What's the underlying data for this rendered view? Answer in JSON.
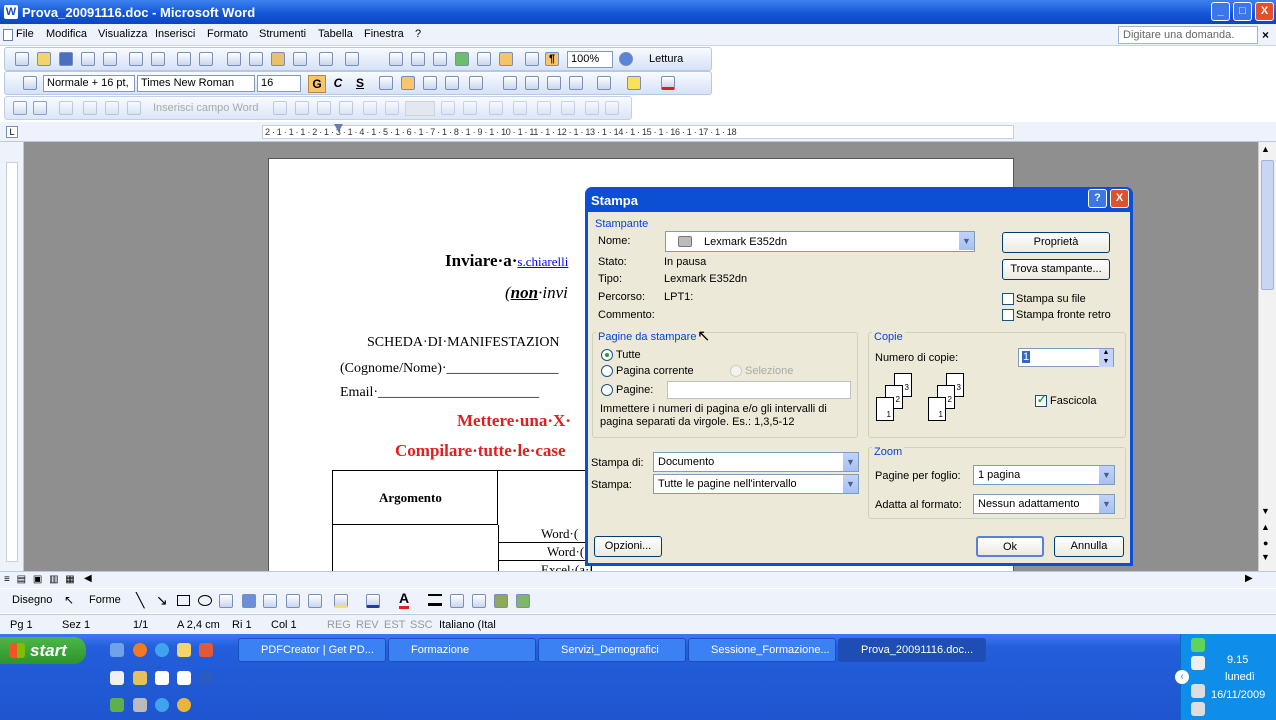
{
  "window": {
    "title": "Prova_20091116.doc - Microsoft Word",
    "min": "_",
    "max": "□",
    "close": "X"
  },
  "menu": {
    "items": [
      "File",
      "Modifica",
      "Visualizza",
      "Inserisci",
      "Formato",
      "Strumenti",
      "Tabella",
      "Finestra",
      "?"
    ],
    "ask": "Digitare una domanda."
  },
  "toolbar": {
    "zoom": "100%",
    "reading": "Lettura",
    "style": "Normale + 16 pt,",
    "font": "Times New Roman",
    "size": "16",
    "bold": "G",
    "italic": "C",
    "underline": "S",
    "field": "Inserisci campo Word"
  },
  "ruler": {
    "marks": "2 · 1 · 1 · 1 · 2 · 1 · 3 · 1 · 4 · 1 · 5 · 1 · 6 · 1 · 7 · 1 · 8 · 1 · 9 · 1 · 10 · 1 · 11 · 1 · 12 · 1 · 13 · 1 · 14 · 1 · 15 · 1 · 16 · 1 · 17 · 1 · 18"
  },
  "document": {
    "line1_bold": "Inviare·a·",
    "line1_link": "s.chiarelli",
    "line2": "(non·invi",
    "line2_bold": "non",
    "line3": "SCHEDA·DI·MANIFESTAZION",
    "line4": "(Cognome/Nome)·________________",
    "line5": "Email·_______________________",
    "line6": "Mettere·una·X·",
    "line7": "Compilare·tutte·le·case",
    "table_header": "Argomento",
    "row1": "Word·(",
    "row2": "Word·(",
    "row3": "Excel·(a·livello·elementare)"
  },
  "dialog": {
    "title": "Stampa",
    "help": "?",
    "close": "X",
    "printer_group": "Stampante",
    "name_label": "Nome:",
    "name_value": "Lexmark E352dn",
    "stato_label": "Stato:",
    "stato_value": "In pausa",
    "tipo_label": "Tipo:",
    "tipo_value": "Lexmark E352dn",
    "percorso_label": "Percorso:",
    "percorso_value": "LPT1:",
    "commento_label": "Commento:",
    "btn_properties": "Proprietà",
    "btn_find": "Trova stampante...",
    "chk_file": "Stampa su file",
    "chk_duplex": "Stampa fronte retro",
    "pages_group": "Pagine da stampare",
    "radio_all": "Tutte",
    "radio_current": "Pagina corrente",
    "radio_selection": "Selezione",
    "radio_pages": "Pagine:",
    "pages_help": "Immettere i numeri di pagina e/o gli intervalli di pagina separati da virgole. Es.: 1,3,5-12",
    "copies_group": "Copie",
    "copies_label": "Numero di copie:",
    "copies_value": "1",
    "collate": "Fascicola",
    "print_what_label": "Stampa di:",
    "print_what_value": "Documento",
    "print_label": "Stampa:",
    "print_value": "Tutte le pagine nell'intervallo",
    "zoom_group": "Zoom",
    "pps_label": "Pagine per foglio:",
    "pps_value": "1 pagina",
    "scale_label": "Adatta al formato:",
    "scale_value": "Nessun adattamento",
    "btn_options": "Opzioni...",
    "btn_ok": "Ok",
    "btn_cancel": "Annulla",
    "collate_stack_a": [
      "3",
      "2",
      "1"
    ],
    "collate_stack_b": [
      "3",
      "2",
      "1"
    ]
  },
  "drawbar": {
    "draw": "Disegno",
    "shapes": "Forme"
  },
  "status": {
    "page": "Pg 1",
    "section": "Sez 1",
    "pages": "1/1",
    "at": "A 2,4 cm",
    "line": "Ri 1",
    "col": "Col 1",
    "reg": "REG",
    "rev": "REV",
    "est": "EST",
    "ssc": "SSC",
    "lang": "Italiano (Ital"
  },
  "taskbar": {
    "start": "start",
    "tasks": [
      "PDFCreator | Get PD...",
      "Formazione",
      "Servizi_Demografici",
      "Sessione_Formazione...",
      "Prova_20091116.doc..."
    ],
    "time": "9.15",
    "day": "lunedì",
    "date": "16/11/2009"
  }
}
